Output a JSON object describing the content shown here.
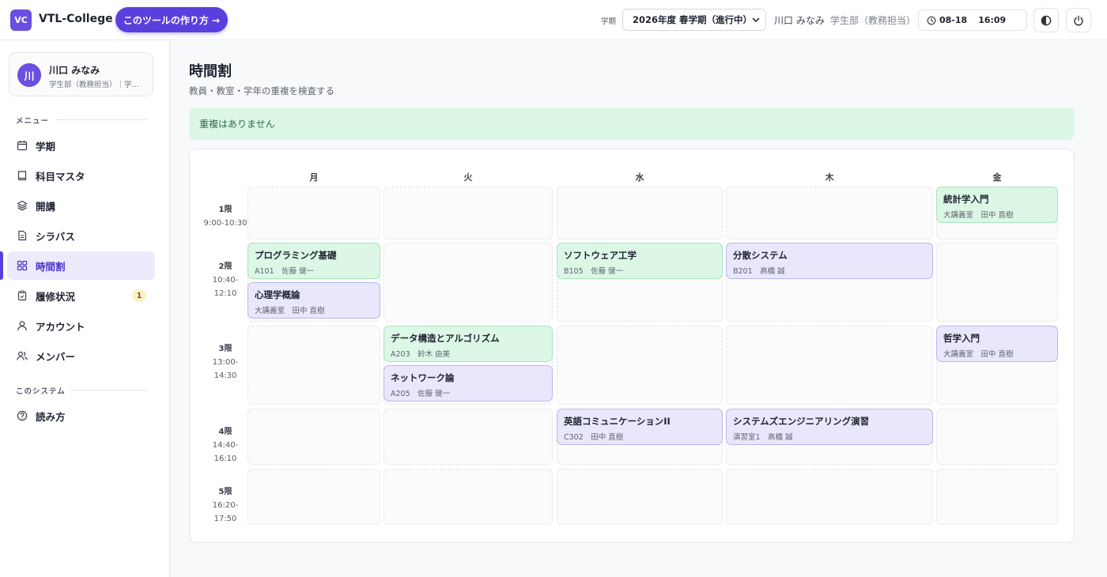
{
  "header": {
    "logo": "VC",
    "app_name": "VTL-College",
    "howto_button": "このツールの作り方 →",
    "term_label": "学期",
    "term_selected": "2026年度 春学期（進行中）",
    "user_name": "川口 みなみ",
    "user_dept": "学生部（教務担当）",
    "date": "08-18",
    "time": "16:09"
  },
  "sidebar": {
    "profile": {
      "avatar": "川",
      "name": "川口 みなみ",
      "sub": "学生部（教務担当）｜学…"
    },
    "menu_label": "メニュー",
    "items": [
      {
        "label": "学期"
      },
      {
        "label": "科目マスタ"
      },
      {
        "label": "開講"
      },
      {
        "label": "シラバス"
      },
      {
        "label": "時間割"
      },
      {
        "label": "履修状況",
        "badge": "1"
      },
      {
        "label": "アカウント"
      },
      {
        "label": "メンバー"
      }
    ],
    "system_label": "このシステム",
    "system_items": [
      {
        "label": "読み方"
      }
    ]
  },
  "main": {
    "title": "時間割",
    "subtitle": "教員・教室・学年の重複を検査する",
    "alert": "重複はありません",
    "days": [
      "月",
      "火",
      "水",
      "木",
      "金"
    ],
    "periods": [
      {
        "name": "1限",
        "start": "9:00-10:30",
        "end": ""
      },
      {
        "name": "2限",
        "start": "10:40-",
        "end": "12:10"
      },
      {
        "name": "3限",
        "start": "13:00-",
        "end": "14:30"
      },
      {
        "name": "4限",
        "start": "14:40-",
        "end": "16:10"
      },
      {
        "name": "5限",
        "start": "16:20-",
        "end": "17:50"
      }
    ],
    "courses": [
      {
        "name": "統計学入門",
        "meta": "大講義室　田中 直樹",
        "color": "green"
      },
      {
        "name": "プログラミング基礎",
        "meta": "A101　佐藤 健一",
        "color": "green"
      },
      {
        "name": "心理学概論",
        "meta": "大講義室　田中 直樹",
        "color": "purple"
      },
      {
        "name": "ソフトウェア工学",
        "meta": "B105　佐藤 健一",
        "color": "green"
      },
      {
        "name": "分散システム",
        "meta": "B201　高橋 誠",
        "color": "purple"
      },
      {
        "name": "データ構造とアルゴリズム",
        "meta": "A203　鈴木 由美",
        "color": "green"
      },
      {
        "name": "ネットワーク論",
        "meta": "A205　佐藤 健一",
        "color": "purple"
      },
      {
        "name": "哲学入門",
        "meta": "大講義室　田中 直樹",
        "color": "purple"
      },
      {
        "name": "英語コミュニケーションII",
        "meta": "C302　田中 直樹",
        "color": "purple"
      },
      {
        "name": "システムズエンジニアリング演習",
        "meta": "演習室1　高橋 誠",
        "color": "purple"
      }
    ]
  },
  "colors": {
    "accent": "#5b3fdc",
    "green_bg": "#dcf7e6",
    "purple_bg": "#e9e7fb"
  }
}
